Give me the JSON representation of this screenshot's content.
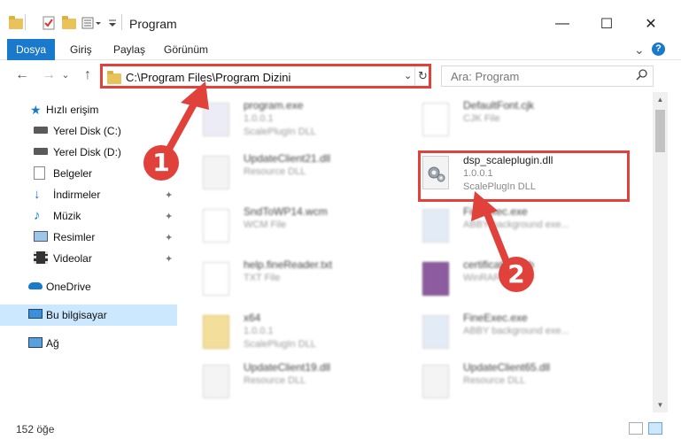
{
  "window": {
    "title": "Program",
    "minimize": "—",
    "maximize": "☐",
    "close": "✕"
  },
  "ribbon": {
    "tabs": [
      "Dosya",
      "Giriş",
      "Paylaş",
      "Görünüm"
    ],
    "expand_icon": "⌄",
    "help_icon": "?"
  },
  "nav": {
    "back": "←",
    "forward": "→",
    "recent": "⌄",
    "up": "↑",
    "address": "C:\\Program Files\\Program Dizini",
    "address_dropdown": "⌄",
    "refresh": "↻",
    "search_placeholder": "Ara: Program",
    "search_icon": "⌕"
  },
  "sidebar": {
    "items": [
      {
        "label": "Hızlı erişim",
        "icon": "star-icon"
      },
      {
        "label": "Yerel Disk (C:)",
        "icon": "drive-icon"
      },
      {
        "label": "Yerel Disk (D:)",
        "icon": "drive-icon"
      },
      {
        "label": "Belgeler",
        "icon": "documents-icon"
      },
      {
        "label": "İndirmeler",
        "icon": "download-icon",
        "pinned": true
      },
      {
        "label": "Müzik",
        "icon": "music-icon",
        "pinned": true
      },
      {
        "label": "Resimler",
        "icon": "pictures-icon",
        "pinned": true
      },
      {
        "label": "Videolar",
        "icon": "video-icon",
        "pinned": true
      },
      {
        "label": "OneDrive",
        "icon": "cloud-icon"
      },
      {
        "label": "Bu bilgisayar",
        "icon": "computer-icon",
        "selected": true
      },
      {
        "label": "Ağ",
        "icon": "network-icon"
      }
    ],
    "pin_glyph": "📌"
  },
  "files": {
    "left": [
      {
        "name": "program.exe",
        "line2": "1.0.0.1",
        "line3": "ScalePlugIn DLL"
      },
      {
        "name": "UpdateClient21.dll",
        "line2": "Resource DLL",
        "line3": ""
      },
      {
        "name": "SndToWP14.wcm",
        "line2": "WCM File",
        "line3": ""
      },
      {
        "name": "help.fineReader.txt",
        "line2": "TXT File",
        "line3": ""
      },
      {
        "name": "x64",
        "line2": "1.0.0.1",
        "line3": "ScalePlugIn DLL"
      },
      {
        "name": "UpdateClient19.dll",
        "line2": "Resource DLL",
        "line3": ""
      }
    ],
    "right": [
      {
        "name": "DefaultFont.cjk",
        "line2": "CJK File",
        "line3": ""
      },
      {
        "name": "dsp_scaleplugin.dll",
        "line2": "1.0.0.1",
        "line3": "ScalePlugIn DLL"
      },
      {
        "name": "FineExec.exe",
        "line2": "ABBY background exe...",
        "line3": ""
      },
      {
        "name": "certificates.cab",
        "line2": "WinRAR archive",
        "line3": ""
      },
      {
        "name": "FineExec.exe",
        "line2": "ABBY background exe...",
        "line3": ""
      },
      {
        "name": "UpdateClient65.dll",
        "line2": "Resource DLL",
        "line3": ""
      }
    ]
  },
  "status": {
    "count": "152 öğe"
  },
  "callouts": {
    "one": "1",
    "two": "2"
  },
  "colors": {
    "accent": "#1979ca",
    "highlight": "#e0413a",
    "selected_bg": "#cce8ff"
  }
}
